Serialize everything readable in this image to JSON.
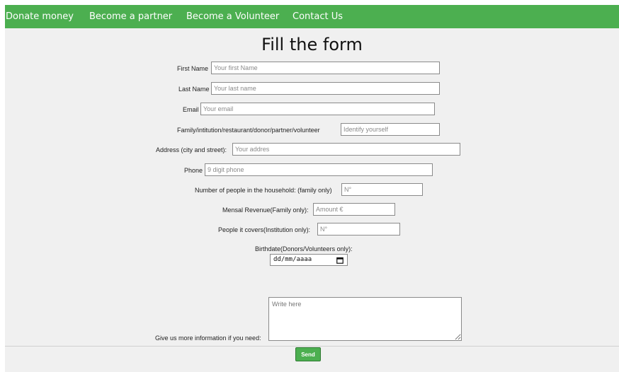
{
  "nav": {
    "items": [
      "Donate money",
      "Become a partner",
      "Become a Volunteer",
      "Contact Us"
    ],
    "background_color": "#4caf50"
  },
  "form": {
    "title": "Fill the form",
    "fields": [
      {
        "label": "First Name",
        "placeholder": "Your first Name"
      },
      {
        "label": "Last Name",
        "placeholder": "Your last name"
      },
      {
        "label": "Email",
        "placeholder": "Your email"
      },
      {
        "label": "Family/intitution/restaurant/donor/partner/volunteer",
        "placeholder": "Identify yourself"
      },
      {
        "label": "Address (city and street):",
        "placeholder": "Your addres"
      },
      {
        "label": "Phone",
        "placeholder": "9 digit phone"
      },
      {
        "label": "Number of people in the household: (family only)",
        "placeholder": "N°"
      },
      {
        "label": "Mensal Revenue(Family only):",
        "placeholder": "Amount €"
      },
      {
        "label": "People it covers(Institution only):",
        "placeholder": "N°"
      }
    ],
    "birthdate": {
      "label": "Birthdate(Donors/Volunteers only):",
      "value": "dd/mm/aaaa",
      "icon": "calendar-icon"
    },
    "more_info": {
      "label": "Give us more information if you need:",
      "placeholder": "Write here"
    },
    "send_label": "Send",
    "send_color": "#4caf50"
  }
}
